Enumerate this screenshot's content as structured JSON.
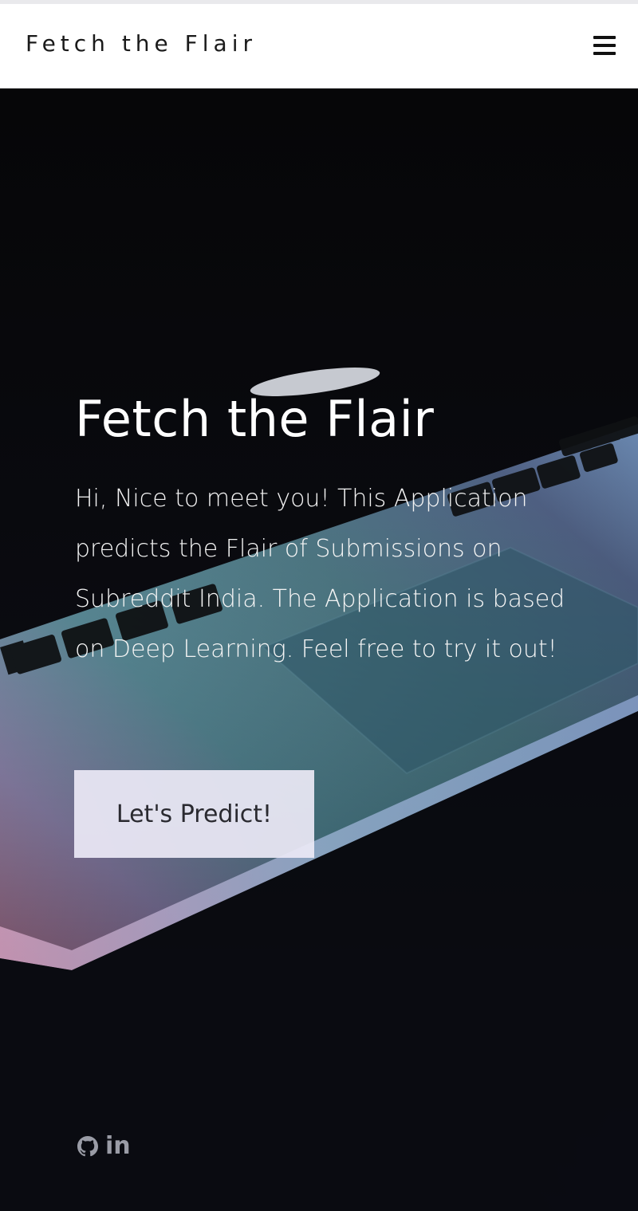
{
  "navbar": {
    "brand": "Fetch the Flair",
    "menu_icon": "hamburger-menu-icon"
  },
  "hero": {
    "title": "Fetch the Flair",
    "description": "Hi, Nice to meet you! This Application predicts the Flair of Submissions on Subreddit India. The Application is based on Deep Learning. Feel free to try it out!",
    "cta_label": "Let's Predict!",
    "background_image": "laptop-keyboard-photo"
  },
  "social": {
    "github_icon": "github-icon",
    "linkedin_label": "in"
  },
  "colors": {
    "navbar_bg": "#ffffff",
    "hero_bg": "#0b0c10",
    "button_bg": "#ebe8f5",
    "text_light": "#ffffff",
    "social_icon": "#9a9ca6"
  }
}
